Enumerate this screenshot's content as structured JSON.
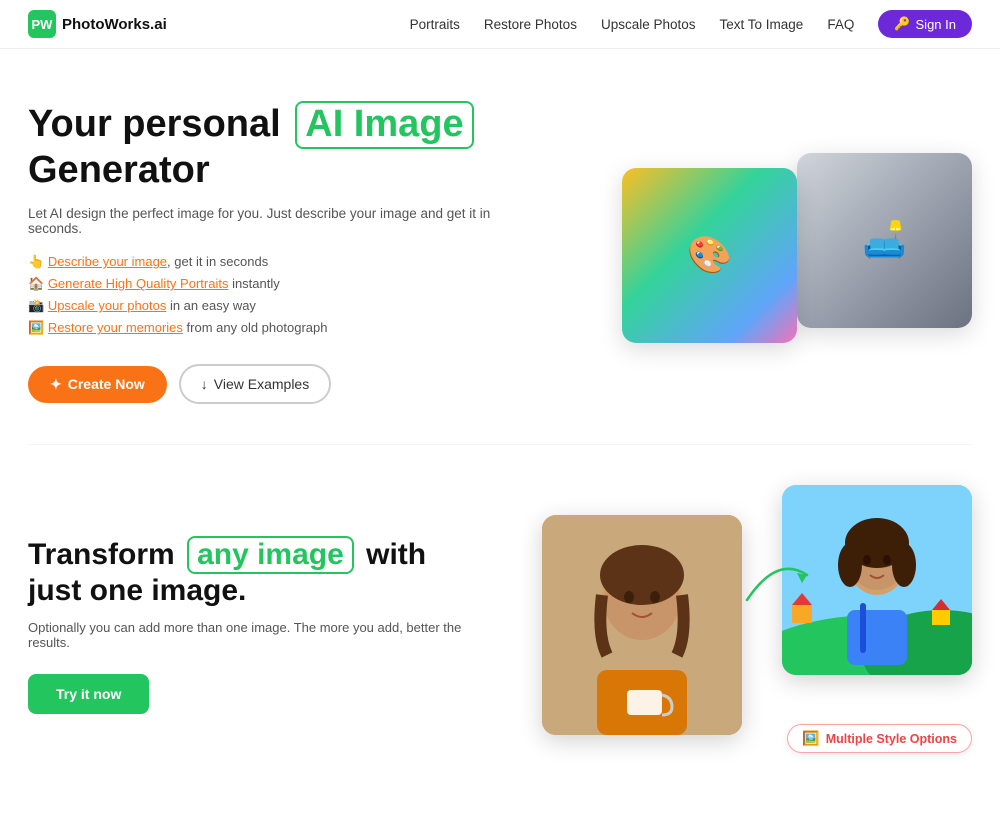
{
  "navbar": {
    "logo_icon": "PW",
    "logo_text": "PhotoWorks.ai",
    "nav_links": [
      {
        "label": "Portraits",
        "href": "#"
      },
      {
        "label": "Restore Photos",
        "href": "#"
      },
      {
        "label": "Upscale Photos",
        "href": "#"
      },
      {
        "label": "Text To Image",
        "href": "#"
      },
      {
        "label": "FAQ",
        "href": "#"
      }
    ],
    "signin_label": "Sign In"
  },
  "hero": {
    "title_part1": "Your personal",
    "title_highlight": "AI Image",
    "title_part2": "Generator",
    "subtitle": "Let AI design the perfect image for you. Just describe your image and get it in seconds.",
    "features": [
      {
        "emoji": "👆",
        "link_text": "Describe your image",
        "suffix": ", get it in seconds"
      },
      {
        "emoji": "🏠",
        "link_text": "Generate High Quality Portraits",
        "suffix": " instantly"
      },
      {
        "emoji": "📸",
        "link_text": "Upscale your photos",
        "suffix": " in an easy way"
      },
      {
        "emoji": "🖼️",
        "link_text": "Restore your memories",
        "suffix": " from any old photograph"
      }
    ],
    "create_btn": "✦ Create Now",
    "examples_btn": "↓ View Examples",
    "img_left_emoji": "🎨",
    "img_right_emoji": "🛋️"
  },
  "transform": {
    "title_part1": "Transform",
    "title_highlight": "any image",
    "title_part2": "with just one image.",
    "subtitle": "Optionally you can add more than one image. The more you add, better the results.",
    "try_btn": "Try it now",
    "img_before_emoji": "☕",
    "img_after_emoji": "🌿",
    "style_badge": "Multiple Style Options",
    "arrow": "→"
  },
  "colors": {
    "accent_green": "#22c55e",
    "accent_orange": "#f97316",
    "accent_purple": "#6d28d9",
    "badge_red": "#ef4444"
  }
}
